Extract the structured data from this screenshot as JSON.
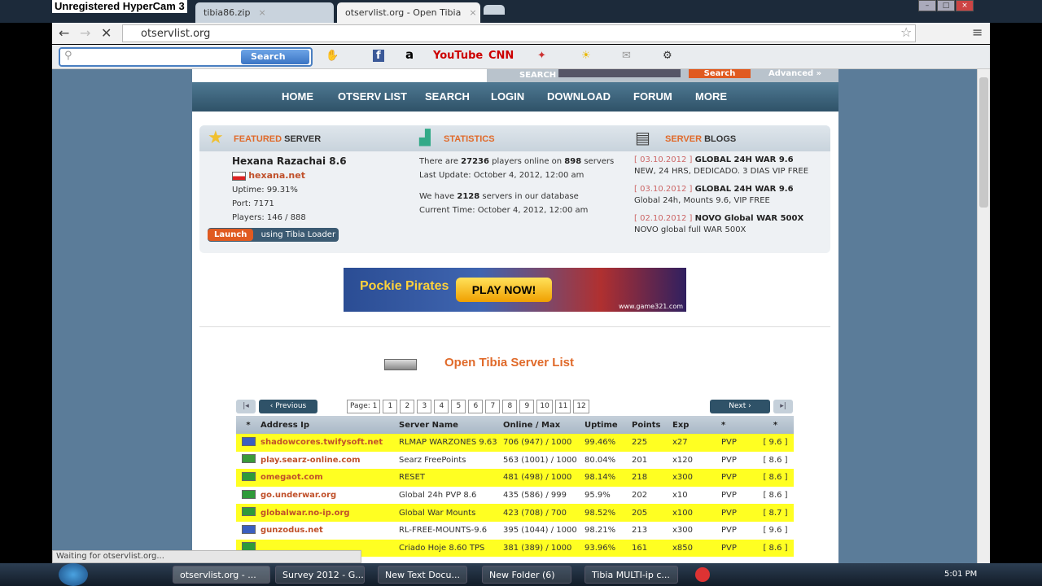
{
  "recorder_watermark": "Unregistered HyperCam 3",
  "browser": {
    "tabs": [
      {
        "label": "tibia86.zip"
      },
      {
        "label": "otservlist.org - Open Tibia"
      }
    ],
    "url": "otservlist.org",
    "status": "Waiting for otservlist.org..."
  },
  "toolbar": {
    "search_placeholder": "",
    "search_label": "Search",
    "brands": [
      "f",
      "a",
      "YouTube",
      "CNN"
    ]
  },
  "site": {
    "top_search": {
      "label": "SEARCH",
      "button": "Search",
      "advanced": "Advanced »"
    },
    "menu": [
      "HOME",
      "OTSERV LIST",
      "SEARCH",
      "LOGIN",
      "DOWNLOAD",
      "FORUM",
      "MORE"
    ],
    "featured": {
      "title_a": "FEATURED",
      "title_b": " SERVER",
      "name": "Hexana Razachai 8.6",
      "host": "hexana.net",
      "uptime": "Uptime: 99.31%",
      "port": "Port: 7171",
      "players": "Players: 146 / 888",
      "launch": "Launch",
      "loader": "using Tibia Loader"
    },
    "statistics": {
      "title": "STATISTICS",
      "l1a": "There are ",
      "players": "27236",
      "l1b": " players online on ",
      "servers": "898",
      "l1c": " servers",
      "update": "Last Update: October 4, 2012, 12:00 am",
      "l2a": "We have ",
      "db": "2128",
      "l2b": " servers in our database",
      "time": "Current Time: October 4, 2012, 12:00 am"
    },
    "blogs": {
      "title_a": "SERVER",
      "title_b": " BLOGS",
      "items": [
        {
          "date": "[ 03.10.2012 ]",
          "title": "GLOBAL 24H WAR 9.6",
          "desc": "NEW, 24 HRS, DEDICADO. 3 DIAS VIP FREE"
        },
        {
          "date": "[ 03.10.2012 ]",
          "title": "GLOBAL 24H WAR 9.6",
          "desc": "Global 24h, Mounts 9.6, VIP FREE"
        },
        {
          "date": "[ 02.10.2012 ]",
          "title": "NOVO Global WAR 500X",
          "desc": "NOVO global full WAR 500X"
        }
      ]
    },
    "banner": {
      "brand": "Pockie Pirates",
      "cta": "PLAY NOW!",
      "site": "www.game321.com"
    },
    "list_title": "Open Tibia Server List",
    "pager": {
      "first": "|◂",
      "prev": "‹ Previous",
      "page_label": "Page: 1",
      "pages": [
        "1",
        "2",
        "3",
        "4",
        "5",
        "6",
        "7",
        "8",
        "9",
        "10",
        "11",
        "12"
      ],
      "next": "Next ›",
      "last": "▸|"
    },
    "table": {
      "headers": [
        "*",
        "Address Ip",
        "Server Name",
        "Online / Max",
        "Uptime",
        "Points",
        "Exp",
        "*",
        "*"
      ],
      "rows": [
        {
          "flag": "#3b5fc0",
          "addr": "shadowcores.twifysoft.net",
          "name": "RLMAP WARZONES 9.63",
          "online": "706 (947) / 1000",
          "uptime": "99.46%",
          "points": "225",
          "exp": "x27",
          "type": "PVP",
          "ver": "[ 9.6 ]"
        },
        {
          "flag": "#3a9a3a",
          "addr": "play.searz-online.com",
          "name": "Searz FreePoints",
          "online": "563 (1001) / 1000",
          "uptime": "80.04%",
          "points": "201",
          "exp": "x120",
          "type": "PVP",
          "ver": "[ 8.6 ]"
        },
        {
          "flag": "#2f9a3a",
          "addr": "omegaot.com",
          "name": "RESET",
          "online": "481 (498) / 1000",
          "uptime": "98.14%",
          "points": "218",
          "exp": "x300",
          "type": "PVP",
          "ver": "[ 8.6 ]"
        },
        {
          "flag": "#2f9a3a",
          "addr": "go.underwar.org",
          "name": "Global 24h PVP 8.6",
          "online": "435 (586) / 999",
          "uptime": "95.9%",
          "points": "202",
          "exp": "x10",
          "type": "PVP",
          "ver": "[ 8.6 ]"
        },
        {
          "flag": "#2f9a3a",
          "addr": "globalwar.no-ip.org",
          "name": "Global War Mounts",
          "online": "423 (708) / 700",
          "uptime": "98.52%",
          "points": "205",
          "exp": "x100",
          "type": "PVP",
          "ver": "[ 8.7 ]"
        },
        {
          "flag": "#3b5fc0",
          "addr": "gunzodus.net",
          "name": "RL-FREE-MOUNTS-9.6",
          "online": "395 (1044) / 1000",
          "uptime": "98.21%",
          "points": "213",
          "exp": "x300",
          "type": "PVP",
          "ver": "[ 9.6 ]"
        },
        {
          "flag": "#2f9a3a",
          "addr": "",
          "name": "Criado Hoje 8.60 TPS",
          "online": "381 (389) / 1000",
          "uptime": "93.96%",
          "points": "161",
          "exp": "x850",
          "type": "PVP",
          "ver": "[ 8.6 ]"
        }
      ]
    }
  },
  "taskbar": {
    "items": [
      "otservlist.org - ...",
      "Survey 2012 - G...",
      "New Text Docu...",
      "New Folder (6)",
      "Tibia MULTI-ip c..."
    ],
    "clock": "5:01 PM"
  },
  "colors": {
    "accent": "#e06a2a",
    "highlight": "#ffff22",
    "nav": "#2f5268"
  }
}
